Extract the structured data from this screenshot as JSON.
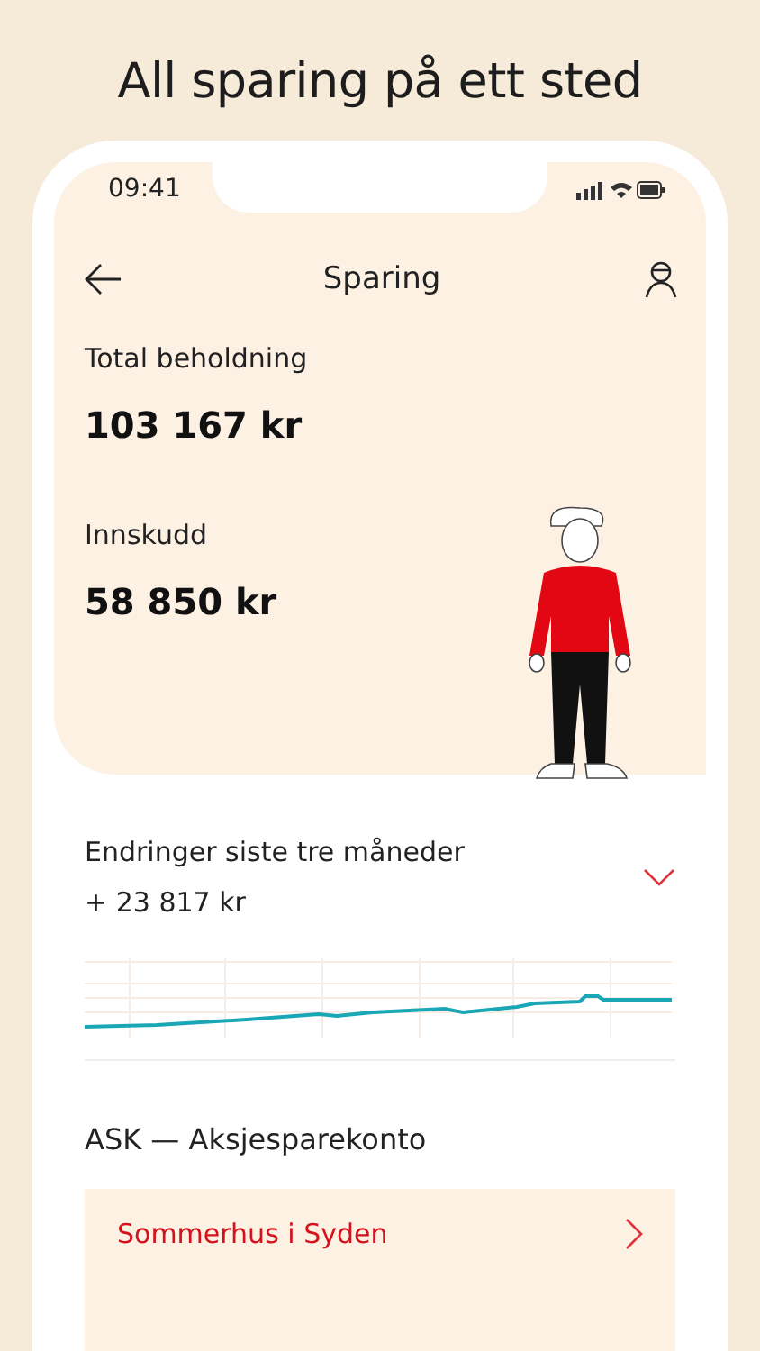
{
  "headline": "All sparing på ett sted",
  "status_bar": {
    "time": "09:41"
  },
  "nav": {
    "title": "Sparing"
  },
  "summary": [
    {
      "label": "Total beholdning",
      "value": "103 167 kr"
    },
    {
      "label": "Innskudd",
      "value": "58 850 kr"
    }
  ],
  "changes": {
    "label": "Endringer siste tre måneder",
    "value": "+ 23 817 kr",
    "expanded": false
  },
  "account": {
    "title": "ASK — Aksjesparekonto",
    "goals": [
      {
        "name": "Sommerhus i Syden"
      }
    ]
  }
}
